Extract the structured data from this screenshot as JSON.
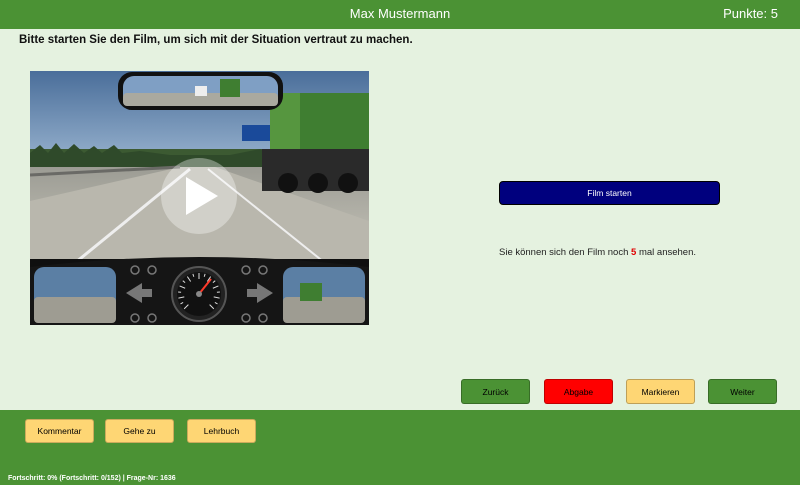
{
  "header": {
    "user_name": "Max Mustermann",
    "points_label": "Punkte: 5"
  },
  "question": {
    "text": "Bitte starten Sie den Film, um sich mit der Situation vertraut zu machen."
  },
  "video": {
    "play_icon": "play-icon",
    "speedometer_ticks": [
      "0",
      "20",
      "40",
      "60",
      "80",
      "100",
      "120",
      "140",
      "160"
    ]
  },
  "film": {
    "start_label": "Film starten",
    "remaining_prefix": "Sie können sich den Film noch",
    "remaining_count": "5",
    "remaining_suffix": "mal ansehen."
  },
  "nav": {
    "back": "Zurück",
    "submit": "Abgabe",
    "mark": "Markieren",
    "next": "Weiter"
  },
  "footer": {
    "comment": "Kommentar",
    "goto": "Gehe zu",
    "textbook": "Lehrbuch",
    "progress": "Fortschritt: 0% (Fortschritt: 0/152) | Frage-Nr: 1636"
  },
  "colors": {
    "green": "#4b9234",
    "yellow": "#fed674",
    "red": "#ff0000",
    "navy": "#00007e",
    "background": "#e5f2e0"
  }
}
